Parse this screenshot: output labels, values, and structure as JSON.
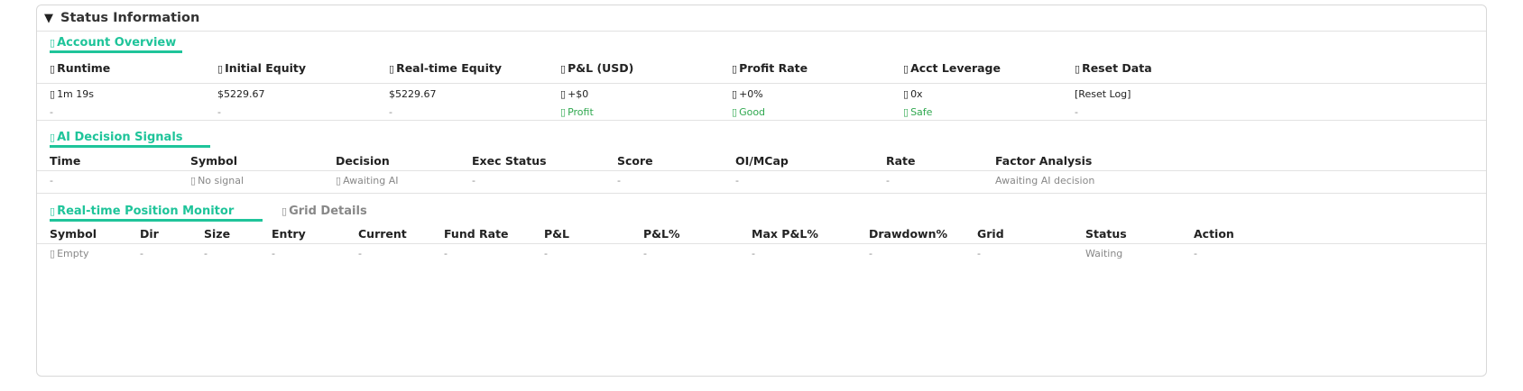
{
  "panel": {
    "title": "Status Information",
    "collapse_icon": "triangle-down-icon"
  },
  "account": {
    "title": "Account Overview",
    "headers": [
      "Runtime",
      "Initial Equity",
      "Real-time Equity",
      "P&L (USD)",
      "Profit Rate",
      "Acct Leverage",
      "Reset Data"
    ],
    "row1": [
      "1m 19s",
      "$5229.67",
      "$5229.67",
      "+$0",
      "+0%",
      "0x",
      "[Reset Log]"
    ],
    "row2": [
      "-",
      "-",
      "-",
      "Profit",
      "Good",
      "Safe",
      "-"
    ]
  },
  "signals": {
    "title": "AI Decision Signals",
    "headers": [
      "Time",
      "Symbol",
      "Decision",
      "Exec Status",
      "Score",
      "OI/MCap",
      "Rate",
      "Factor Analysis"
    ],
    "row": [
      "-",
      "No signal",
      "Awaiting AI",
      "-",
      "-",
      "-",
      "-",
      "Awaiting AI decision"
    ]
  },
  "positions": {
    "tabs": [
      "Real-time Position Monitor",
      "Grid Details"
    ],
    "headers": [
      "Symbol",
      "Dir",
      "Size",
      "Entry",
      "Current",
      "Fund Rate",
      "P&L",
      "P&L%",
      "Max P&L%",
      "Drawdown%",
      "Grid",
      "Status",
      "Action"
    ],
    "row": [
      "Empty",
      "-",
      "-",
      "-",
      "-",
      "-",
      "-",
      "-",
      "-",
      "-",
      "-",
      "Waiting",
      "-"
    ]
  },
  "colors": {
    "accent": "#1fc49a",
    "positive": "#2fa84f",
    "muted": "#888888"
  }
}
